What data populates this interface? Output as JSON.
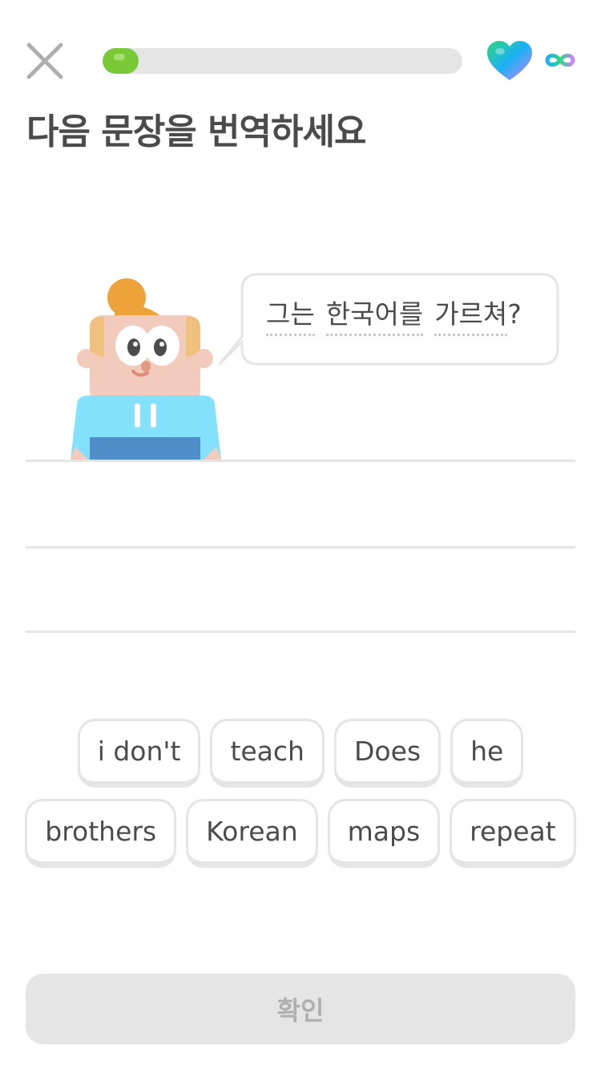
{
  "header": {
    "progress_fraction": 0.1,
    "close_icon": "close-icon",
    "hearts_icon": "heart-icon",
    "hearts_count_icon": "infinity-icon"
  },
  "title": "다음 문장을 번역하세요",
  "speech": {
    "words": [
      "그는",
      "한국어를",
      "가르쳐"
    ],
    "punctuation": "?"
  },
  "word_bank": {
    "row1": [
      "i don't",
      "teach",
      "Does",
      "he"
    ],
    "row2": [
      "brothers",
      "Korean",
      "maps",
      "repeat"
    ]
  },
  "footer": {
    "check_label": "확인"
  },
  "colors": {
    "progress": "#78c837",
    "track": "#e5e5e5",
    "text": "#4b4b4b",
    "disabled_button": "#e5e5e5",
    "disabled_text": "#afafaf"
  }
}
